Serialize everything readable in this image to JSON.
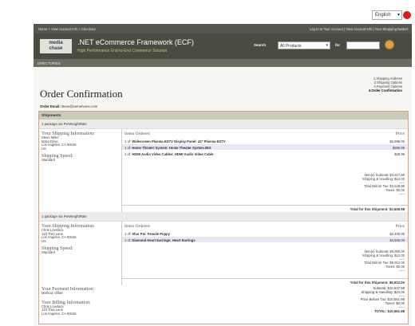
{
  "language": {
    "selected": "English"
  },
  "topnav": {
    "crumbs": "Home > View Account Info > Checkout",
    "links": "Log In to Your Account | View Account Info | Your Shopping Basket"
  },
  "brand": {
    "logo_top": "media",
    "logo_bottom": "chase",
    "title": ".NET eCommerce Framework (ECF)",
    "subtitle": "High Performance End-to-End Commerce Solution"
  },
  "search": {
    "label": "Search",
    "category": "All Products",
    "for_label": "for",
    "query": ""
  },
  "directories_label": "DIRECTORIES",
  "page_title": "Order Confirmation",
  "steps": [
    "1.Shipping Address",
    "2.Shipping Options",
    "3.Payment Options",
    "4.Order Confirmation"
  ],
  "email": {
    "label": "Order Email:",
    "value": "steve@somehome.com"
  },
  "shipments_label": "Shipments",
  "packages": [
    {
      "label": "1 package via PerWeightRate",
      "ship_info_label": "Your Shipping Information:",
      "address": [
        "Steve Miller",
        "Bobo Drive",
        "Los Angeles, CA 90046",
        "US"
      ],
      "speed_label": "Shipping Speed:",
      "speed": "Standard",
      "items_label": "Items Ordered",
      "price_label": "Price",
      "items": [
        {
          "qty": "1 of:",
          "name": "Widescreen Plasma EDTV Display Panel: 42\" Plasma EDTV",
          "price": "$2,999.00"
        },
        {
          "qty": "1 of:",
          "name": "Home Theater System: Home Theater System BIG",
          "price": "$599.99"
        },
        {
          "qty": "1 of:",
          "name": "HDMI Audio Video Cables: HDMI Audio Video Cable",
          "price": "$29.99"
        }
      ],
      "totals": [
        "Item(s) Subtotal: $3,627.98",
        "Shipping & Handling: $12.00",
        "-----",
        "Total Before Tax: $3,649.98",
        "Taxes: $0.00",
        "-----"
      ],
      "grand": "Total for this Shipment: $3,649.98"
    },
    {
      "label": "1 package via PerWeightRate",
      "ship_info_label": "Your Shipping Information:",
      "address": [
        "Chris Lovelace",
        "123 Tree Lane",
        "Los Angeles, CA 90046",
        "US"
      ],
      "speed_label": "Shipping Speed:",
      "speed": "Standard",
      "items_label": "Items Ordered",
      "price_label": "Price",
      "items": [
        {
          "qty": "1 of:",
          "name": "Shar Pei: Female Puppy",
          "price": "$2,400.00"
        },
        {
          "qty": "1 of:",
          "name": "Diamond Heart Earrings: Heart Earrings",
          "price": "$4,500.00"
        }
      ],
      "totals": [
        "Item(s) Subtotal: $6,900.00",
        "Shipping & Handling: $12.00",
        "-----",
        "Total Before Tax: $6,912.00",
        "Taxes: $0.00",
        "-----"
      ],
      "grand": "Total for this Shipment: $6,912.00"
    }
  ],
  "payment": {
    "label": "Your Payment Information:",
    "method": "Method: Other"
  },
  "billing": {
    "label": "Your Billing Information:",
    "address": [
      "Chris Lovelace",
      "123 Tree Lane",
      "Los Angeles, CA 90046"
    ]
  },
  "summary": [
    "Subtotal: $10,537.98",
    "Shipping & Handling: $24.00",
    "-----",
    "Price Before Tax: $10,561.98",
    "Taxes: $0.00",
    "-----",
    "TOTAL: $10,561.98"
  ]
}
